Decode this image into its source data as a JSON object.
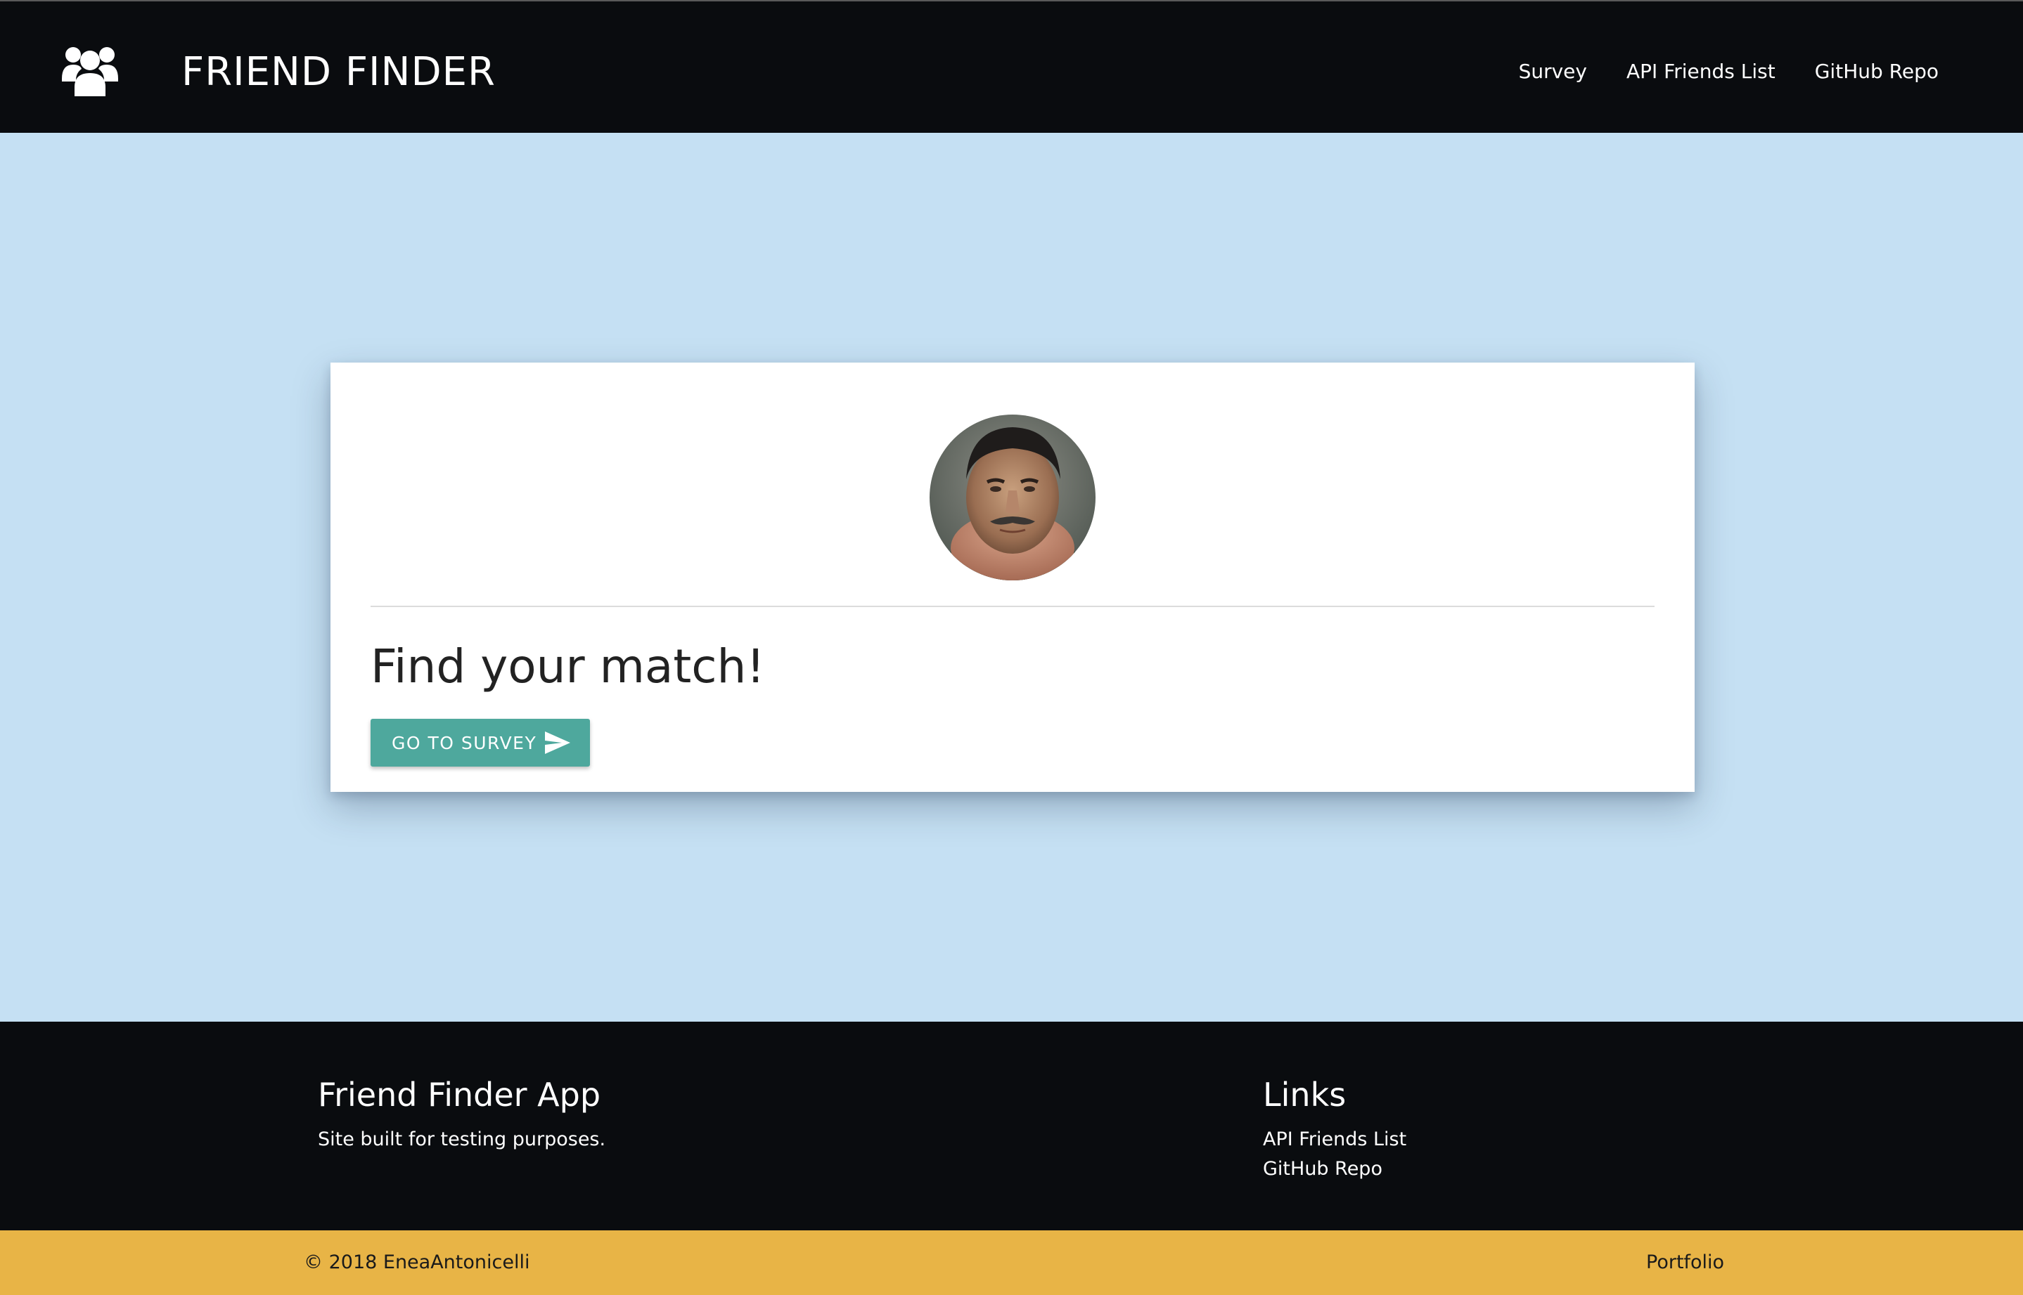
{
  "navbar": {
    "logo_icon": "users-icon",
    "brand": "FRIEND FINDER",
    "links": [
      "Survey",
      "API Friends List",
      "GitHub Repo"
    ]
  },
  "card": {
    "avatar_icon": "profile-photo",
    "heading": "Find your match!",
    "button_label": "GO TO SURVEY",
    "button_icon": "send-icon"
  },
  "footer": {
    "title": "Friend Finder App",
    "description": "Site built for testing purposes.",
    "links_title": "Links",
    "links": [
      "API Friends List",
      "GitHub Repo"
    ]
  },
  "copyright": {
    "text": "© 2018 EneaAntonicelli",
    "portfolio": "Portfolio"
  },
  "colors": {
    "navbar_bg": "#0a0c0f",
    "page_bg": "#c5e0f3",
    "button": "#4ea89d",
    "copyright_bar": "#e8b446"
  }
}
